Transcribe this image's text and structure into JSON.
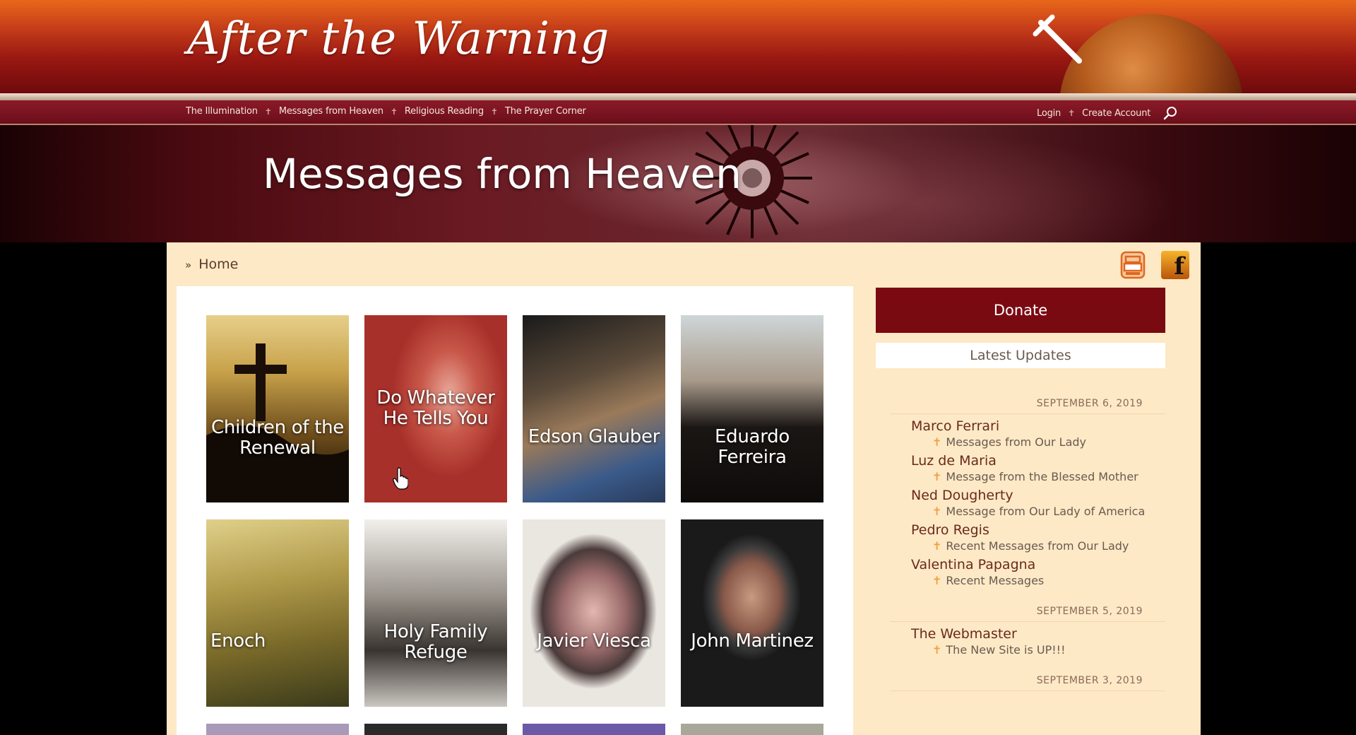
{
  "header": {
    "logo_text": "After the Warning",
    "nav_left": [
      "The Illumination",
      "Messages from Heaven",
      "Religious Reading",
      "The Prayer Corner"
    ],
    "nav_right": [
      "Login",
      "Create Account"
    ],
    "separator": "✝"
  },
  "banner": {
    "title": "Messages from Heaven"
  },
  "breadcrumb": {
    "arrow": "»",
    "home": "Home"
  },
  "tiles": [
    {
      "label": "Children of the Renewal"
    },
    {
      "label": "Do Whatever He Tells You"
    },
    {
      "label": "Edson Glauber"
    },
    {
      "label": "Eduardo Ferreira"
    },
    {
      "label": "Enoch"
    },
    {
      "label": "Holy Family Refuge"
    },
    {
      "label": "Javier Viesca"
    },
    {
      "label": "John Martinez"
    }
  ],
  "sidebar": {
    "donate_label": "Donate",
    "updates_heading": "Latest Updates",
    "groups": [
      {
        "date": "SEPTEMBER 6, 2019",
        "items": [
          {
            "name": "Marco Ferrari",
            "message": "Messages from Our Lady"
          },
          {
            "name": "Luz de Maria",
            "message": "Message from the Blessed Mother"
          },
          {
            "name": "Ned Dougherty",
            "message": "Message from Our Lady of America"
          },
          {
            "name": "Pedro Regis",
            "message": "Recent Messages from Our Lady"
          },
          {
            "name": "Valentina Papagna",
            "message": "Recent Messages"
          }
        ]
      },
      {
        "date": "SEPTEMBER 5, 2019",
        "items": [
          {
            "name": "The Webmaster",
            "message": "The New Site is UP!!!"
          }
        ]
      },
      {
        "date": "SEPTEMBER 3, 2019",
        "items": []
      }
    ]
  },
  "colors": {
    "header_orange": "#e8681a",
    "header_red": "#9a1812",
    "panel_bg": "#fde9c6",
    "donate_bg": "#7a0a12"
  }
}
